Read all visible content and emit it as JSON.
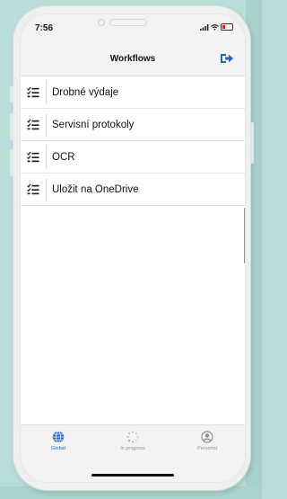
{
  "status_bar": {
    "time": "7:56"
  },
  "nav": {
    "title": "Workflows",
    "action_icon": "logout-icon"
  },
  "workflows": [
    {
      "label": "Drobné výdaje",
      "icon": "checklist-icon"
    },
    {
      "label": "Servisní protokoly",
      "icon": "checklist-icon"
    },
    {
      "label": "OCR",
      "icon": "checklist-icon"
    },
    {
      "label": "Uložit na OneDrive",
      "icon": "checklist-icon"
    }
  ],
  "tabs": [
    {
      "label": "Global",
      "icon": "globe-icon",
      "active": true
    },
    {
      "label": "In progress",
      "icon": "spinner-icon",
      "active": false
    },
    {
      "label": "Personal",
      "icon": "person-icon",
      "active": false
    }
  ],
  "colors": {
    "accent": "#1f68c8",
    "background": "#b9ddd8",
    "inactive_tab": "#8f8f8f"
  }
}
